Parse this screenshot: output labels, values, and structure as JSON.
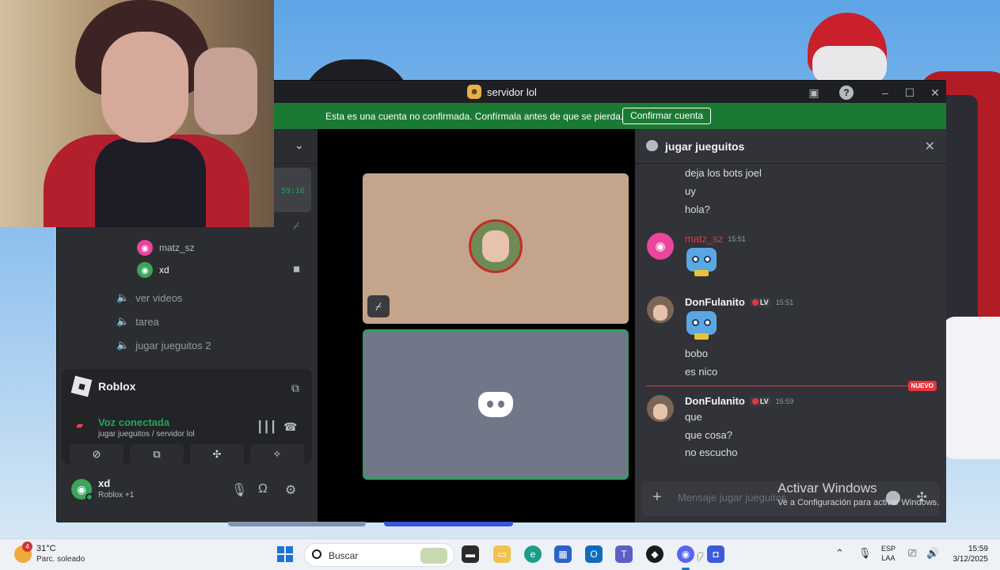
{
  "window": {
    "title": "servidor lol",
    "banner_text": "Esta es una cuenta no confirmada. Confírmala antes de que se pierda.",
    "banner_button": "Confirmar cuenta"
  },
  "sidebar": {
    "timer": "59:16",
    "voice_users": [
      "matz_sz",
      "xd"
    ],
    "channels": [
      "ver videos",
      "tarea",
      "jugar jueguitos 2"
    ],
    "activity": {
      "game": "Roblox",
      "voice_status": "Voz conectada",
      "voice_location": "jugar jueguitos / servidor lol"
    },
    "user": {
      "name": "xd",
      "status": "Roblox +1"
    }
  },
  "chat": {
    "title": "jugar jueguitos",
    "top_lines": [
      "deja los bots joel",
      "uy",
      "hola?"
    ],
    "msg1": {
      "author": "matz_sz",
      "time": "15:51"
    },
    "msg2": {
      "author": "DonFulanito",
      "tag": "LV",
      "time": "15:51",
      "lines": [
        "bobo",
        "es nico"
      ]
    },
    "new_label": "NUEVO",
    "msg3": {
      "author": "DonFulanito",
      "tag": "LV",
      "time": "15:59",
      "lines": [
        "que",
        "que cosa?",
        "no escucho"
      ]
    },
    "composer_placeholder": "Mensaje jugar jueguitos"
  },
  "watermark": {
    "title": "Activar Windows",
    "subtitle": "Ve a Configuración para activar Windows."
  },
  "taskbar": {
    "weather_badge": "4",
    "weather_temp": "31°C",
    "weather_desc": "Parc. soleado",
    "search_label": "Buscar",
    "lang_1": "ESP",
    "lang_2": "LAA",
    "time": "15:59",
    "date": "3/12/2025"
  },
  "colors": {
    "banner_green": "#1a7a34",
    "online_green": "#23a55a",
    "new_red": "#e8353e",
    "discord_bg": "#313338"
  }
}
